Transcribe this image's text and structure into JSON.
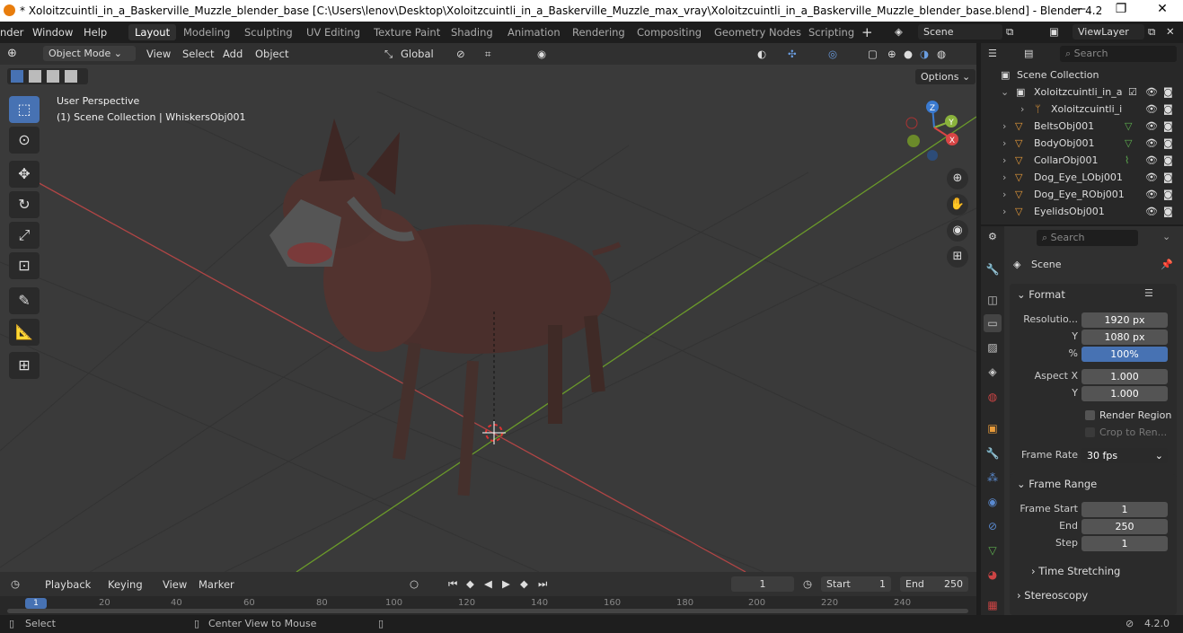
{
  "window": {
    "title": "* Xoloitzcuintli_in_a_Baskerville_Muzzle_blender_base [C:\\Users\\lenov\\Desktop\\Xoloitzcuintli_in_a_Baskerville_Muzzle_max_vray\\Xoloitzcuintli_in_a_Baskerville_Muzzle_blender_base.blend] - Blender 4.2",
    "minimize": "—",
    "maximize": "❐",
    "close": "✕"
  },
  "menu": [
    "nder",
    "Window",
    "Help"
  ],
  "workspaces": [
    "Layout",
    "Modeling",
    "Sculpting",
    "UV Editing",
    "Texture Paint",
    "Shading",
    "Animation",
    "Rendering",
    "Compositing",
    "Geometry Nodes",
    "Scripting"
  ],
  "add_workspace": "+",
  "scene_name": "Scene",
  "view_layer": "ViewLayer",
  "viewport_header": {
    "mode": "Object Mode",
    "menus": [
      "View",
      "Select",
      "Add",
      "Object"
    ],
    "orientation": "Global",
    "options": "Options"
  },
  "viewport": {
    "perspective": "User Perspective",
    "collection_info": "(1) Scene Collection | WhiskersObj001",
    "gizmo_x": "X",
    "gizmo_y": "Y",
    "gizmo_z": "Z"
  },
  "outliner": {
    "search_placeholder": "Search",
    "root": "Scene Collection",
    "items": [
      {
        "label": "Xoloitzcuintli_in_a_"
      },
      {
        "label": "Xoloitzcuintli_i"
      },
      {
        "label": "BeltsObj001"
      },
      {
        "label": "BodyObj001"
      },
      {
        "label": "CollarObj001"
      },
      {
        "label": "Dog_Eye_LObj001"
      },
      {
        "label": "Dog_Eye_RObj001"
      },
      {
        "label": "EyelidsObj001"
      }
    ]
  },
  "properties": {
    "search_placeholder": "Search",
    "context": "Scene",
    "format_title": "Format",
    "resolution_label": "Resolutio...",
    "res_x": "1920 px",
    "y_label": "Y",
    "res_y": "1080 px",
    "pct_label": "%",
    "res_pct": "100%",
    "aspect_x_label": "Aspect X",
    "aspect_x": "1.000",
    "aspect_y": "1.000",
    "render_region": "Render Region",
    "crop": "Crop to Ren...",
    "frame_rate_label": "Frame Rate",
    "frame_rate": "30 fps",
    "frame_range_title": "Frame Range",
    "frame_start_label": "Frame Start",
    "frame_start": "1",
    "end_label": "End",
    "frame_end": "250",
    "step_label": "Step",
    "step": "1",
    "time_stretching": "Time Stretching",
    "stereoscopy": "Stereoscopy"
  },
  "timeline": {
    "menus": [
      "Playback",
      "Keying",
      "View",
      "Marker"
    ],
    "current_frame": "1",
    "start_label": "Start",
    "start": "1",
    "end_label": "End",
    "end": "250",
    "ticks": [
      "1",
      "20",
      "40",
      "60",
      "80",
      "100",
      "120",
      "140",
      "160",
      "180",
      "200",
      "220",
      "240"
    ]
  },
  "status": {
    "select": "Select",
    "center": "Center View to Mouse",
    "version": "4.2.0"
  },
  "colors": {
    "accent": "#4772b3",
    "axis_x": "#c84949",
    "axis_y": "#6b9a2a"
  }
}
